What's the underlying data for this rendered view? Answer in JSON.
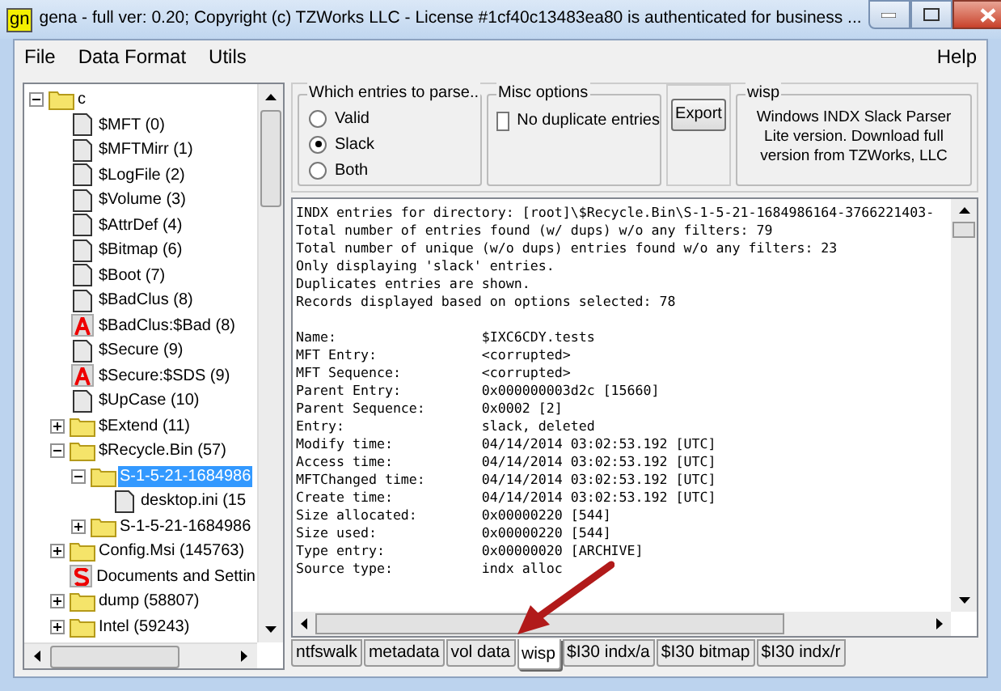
{
  "window": {
    "title": "gena - full ver: 0.20; Copyright (c) TZWorks LLC - License #1cf40c13483ea80 is authenticated for business ...",
    "icon_text": "gn"
  },
  "menu": {
    "left": [
      "File",
      "Data Format",
      "Utils"
    ],
    "right": [
      "Help"
    ]
  },
  "tree": [
    {
      "label": "c",
      "kind": "folder",
      "expanded": true,
      "selected": false,
      "children": [
        {
          "label": "$MFT (0)",
          "kind": "file",
          "selected": false
        },
        {
          "label": "$MFTMirr (1)",
          "kind": "file",
          "selected": false
        },
        {
          "label": "$LogFile (2)",
          "kind": "file",
          "selected": false
        },
        {
          "label": "$Volume (3)",
          "kind": "file",
          "selected": false
        },
        {
          "label": "$AttrDef (4)",
          "kind": "file",
          "selected": false
        },
        {
          "label": "$Bitmap (6)",
          "kind": "file",
          "selected": false
        },
        {
          "label": "$Boot (7)",
          "kind": "file",
          "selected": false
        },
        {
          "label": "$BadClus (8)",
          "kind": "file",
          "selected": false
        },
        {
          "label": "$BadClus:$Bad (8)",
          "kind": "stream",
          "selected": false
        },
        {
          "label": "$Secure (9)",
          "kind": "file",
          "selected": false
        },
        {
          "label": "$Secure:$SDS (9)",
          "kind": "stream",
          "selected": false
        },
        {
          "label": "$UpCase (10)",
          "kind": "file",
          "selected": false
        },
        {
          "label": "$Extend (11)",
          "kind": "folder",
          "expanded": false,
          "selected": false
        },
        {
          "label": "$Recycle.Bin (57)",
          "kind": "folder",
          "expanded": true,
          "selected": false,
          "children": [
            {
              "label": "S-1-5-21-1684986",
              "kind": "folder",
              "expanded": true,
              "selected": true,
              "children": [
                {
                  "label": "desktop.ini (15",
                  "kind": "file",
                  "selected": false
                }
              ]
            },
            {
              "label": "S-1-5-21-1684986",
              "kind": "folder",
              "expanded": false,
              "selected": false
            }
          ]
        },
        {
          "label": "Config.Msi (145763)",
          "kind": "folder",
          "expanded": false,
          "selected": false
        },
        {
          "label": "Documents and Settin",
          "kind": "link",
          "selected": false
        },
        {
          "label": "dump (58807)",
          "kind": "folder",
          "expanded": false,
          "selected": false
        },
        {
          "label": "Intel (59243)",
          "kind": "folder",
          "expanded": false,
          "selected": false
        }
      ]
    }
  ],
  "parse_group": {
    "title": "Which entries to parse..",
    "options": [
      {
        "label": "Valid",
        "selected": false
      },
      {
        "label": "Slack",
        "selected": true
      },
      {
        "label": "Both",
        "selected": false
      }
    ]
  },
  "misc_group": {
    "title": "Misc options",
    "checkbox": {
      "label": "No duplicate entries",
      "checked": false
    }
  },
  "export_button": "Export",
  "wisp_group": {
    "title": "wisp",
    "text": "Windows INDX Slack Parser Lite version. Download full version from TZWorks, LLC"
  },
  "output_blocks": [
    [
      "INDX entries for directory: [root]\\$Recycle.Bin\\S-1-5-21-1684986164-3766221403-",
      "Total number of entries found (w/ dups) w/o any filters: 79",
      "Total number of unique (w/o dups) entries found w/o any filters: 23",
      "Only displaying 'slack' entries.",
      "Duplicates entries are shown.",
      "Records displayed based on options selected: 78"
    ],
    [
      "Name:                  $IXC6CDY.tests",
      "MFT Entry:             <corrupted>",
      "MFT Sequence:          <corrupted>",
      "Parent Entry:          0x000000003d2c [15660]",
      "Parent Sequence:       0x0002 [2]",
      "Entry:                 slack, deleted",
      "Modify time:           04/14/2014 03:02:53.192 [UTC]",
      "Access time:           04/14/2014 03:02:53.192 [UTC]",
      "MFTChanged time:       04/14/2014 03:02:53.192 [UTC]",
      "Create time:           04/14/2014 03:02:53.192 [UTC]",
      "Size allocated:        0x00000220 [544]",
      "Size used:             0x00000220 [544]",
      "Type entry:            0x00000020 [ARCHIVE]",
      "Source type:           indx alloc"
    ]
  ],
  "tabs": [
    {
      "label": "ntfswalk",
      "selected": false
    },
    {
      "label": "metadata",
      "selected": false
    },
    {
      "label": "vol data",
      "selected": false
    },
    {
      "label": "wisp",
      "selected": true
    },
    {
      "label": "$I30 indx/a",
      "selected": false
    },
    {
      "label": "$I30 bitmap",
      "selected": false
    },
    {
      "label": "$I30 indx/r",
      "selected": false
    }
  ]
}
